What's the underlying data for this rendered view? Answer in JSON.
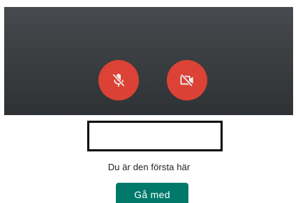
{
  "preview": {
    "mic_icon": "mic-off-icon",
    "camera_icon": "camera-off-icon",
    "button_color": "#ea4335"
  },
  "status": {
    "text": "Du är den första här"
  },
  "join_button": {
    "label": "Gå med",
    "color": "#00796b"
  }
}
